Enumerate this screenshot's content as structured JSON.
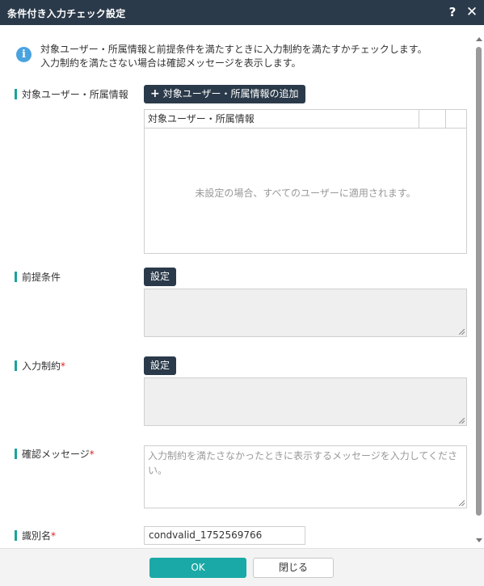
{
  "window": {
    "title": "条件付き入力チェック設定",
    "help_icon": "?",
    "close_icon": "✕"
  },
  "info": {
    "icon": "i",
    "line1": "対象ユーザー・所属情報と前提条件を満たすときに入力制約を満たすかチェックします。",
    "line2": "入力制約を満たさない場合は確認メッセージを表示します。"
  },
  "target": {
    "label": "対象ユーザー・所属情報",
    "add_button": "対象ユーザー・所属情報の追加",
    "grid_header": "対象ユーザー・所属情報",
    "empty_text": "未設定の場合、すべてのユーザーに適用されます。"
  },
  "precondition": {
    "label": "前提条件",
    "set_button": "設定"
  },
  "constraint": {
    "label": "入力制約",
    "required_mark": "*",
    "set_button": "設定"
  },
  "message": {
    "label": "確認メッセージ",
    "required_mark": "*",
    "placeholder": "入力制約を満たさなかったときに表示するメッセージを入力してください。"
  },
  "identifier": {
    "label": "識別名",
    "required_mark": "*",
    "value": "condvalid_1752569766"
  },
  "footer": {
    "ok": "OK",
    "close": "閉じる"
  },
  "colors": {
    "titlebar": "#2b3a4a",
    "accent": "#1aa39a",
    "ok_button": "#1aa9a6",
    "required": "#e02020",
    "info_icon": "#4aa3df"
  }
}
